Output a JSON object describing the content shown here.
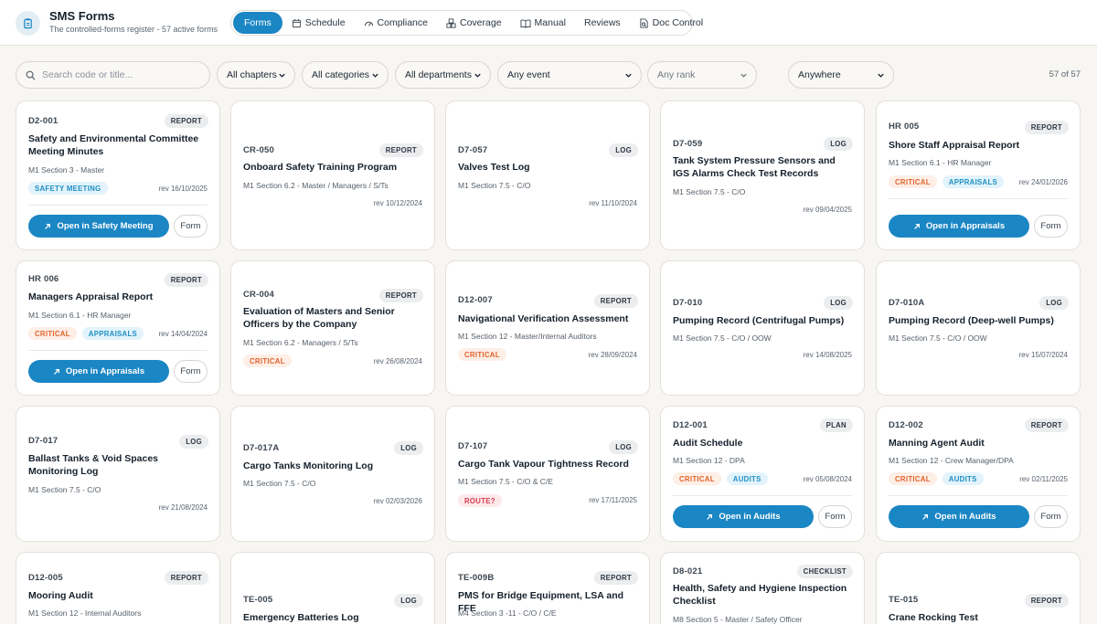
{
  "app": {
    "title": "SMS Forms",
    "subtitle": "The controlled-forms register - 57 active forms"
  },
  "nav": {
    "forms": "Forms",
    "schedule": "Schedule",
    "compliance": "Compliance",
    "coverage": "Coverage",
    "manual": "Manual",
    "reviews": "Reviews",
    "doc_control": "Doc Control"
  },
  "filters": {
    "search_placeholder": "Search code or title...",
    "chapters": "All chapters",
    "categories": "All categories",
    "departments": "All departments",
    "event": "Any event",
    "rank": "Any rank",
    "location": "Anywhere",
    "count": "57 of 57"
  },
  "colors": {
    "accent": "#1b86c4",
    "critical": "#e0632a",
    "route": "#d63c4e"
  },
  "cards": [
    {
      "code": "D2-001",
      "type": "REPORT",
      "title": "Safety and Environmental Committee Meeting Minutes",
      "meta": "M1 Section 3 - Master",
      "tags": [
        "SAFETY MEETING"
      ],
      "rev": "rev 16/10/2025",
      "open": "Open in Safety Meeting",
      "form": "Form"
    },
    {
      "code": "CR-050",
      "type": "REPORT",
      "title": "Onboard Safety Training Program",
      "meta": "M1 Section 6.2 - Master / Managers / S/Ts",
      "rev": "rev 10/12/2024"
    },
    {
      "code": "D7-057",
      "type": "LOG",
      "title": "Valves Test Log",
      "meta": "M1 Section 7.5 - C/O",
      "rev": "rev 11/10/2024"
    },
    {
      "code": "D7-059",
      "type": "LOG",
      "title": "Tank System Pressure Sensors and IGS Alarms Check Test Records",
      "meta": "M1 Section 7.5 - C/O",
      "rev": "rev 09/04/2025"
    },
    {
      "code": "HR 005",
      "type": "REPORT",
      "title": "Shore Staff Appraisal Report",
      "meta": "M1 Section 6.1 - HR Manager",
      "tags": [
        "CRITICAL",
        "APPRAISALS"
      ],
      "rev": "rev 24/01/2026",
      "open": "Open in Appraisals",
      "form": "Form"
    },
    {
      "code": "HR 006",
      "type": "REPORT",
      "title": "Managers Appraisal Report",
      "meta": "M1 Section 6.1 - HR Manager",
      "tags": [
        "CRITICAL",
        "APPRAISALS"
      ],
      "rev": "rev 14/04/2024",
      "open": "Open in Appraisals",
      "form": "Form"
    },
    {
      "code": "CR-004",
      "type": "REPORT",
      "title": "Evaluation of Masters and Senior Officers by the Company",
      "meta": "M1 Section 6.2 - Managers / S/Ts",
      "tags": [
        "CRITICAL"
      ],
      "rev": "rev 26/08/2024"
    },
    {
      "code": "D12-007",
      "type": "REPORT",
      "title": "Navigational Verification Assessment",
      "meta": "M1 Section 12 - Master/Internal Auditors",
      "tags": [
        "CRITICAL"
      ],
      "rev": "rev 28/09/2024"
    },
    {
      "code": "D7-010",
      "type": "LOG",
      "title": "Pumping Record (Centrifugal Pumps)",
      "meta": "M1 Section 7.5 - C/O / OOW",
      "rev": "rev 14/08/2025"
    },
    {
      "code": "D7-010A",
      "type": "LOG",
      "title": "Pumping Record (Deep-well Pumps)",
      "meta": "M1 Section 7.5 - C/O / OOW",
      "rev": "rev 15/07/2024"
    },
    {
      "code": "D7-017",
      "type": "LOG",
      "title": "Ballast Tanks & Void Spaces Monitoring Log",
      "meta": "M1 Section 7.5 - C/O",
      "rev": "rev 21/08/2024"
    },
    {
      "code": "D7-017A",
      "type": "LOG",
      "title": "Cargo Tanks Monitoring Log",
      "meta": "M1 Section 7.5 - C/O",
      "rev": "rev 02/03/2026"
    },
    {
      "code": "D7-107",
      "type": "LOG",
      "title": "Cargo Tank Vapour Tightness Record",
      "meta": "M1 Section 7.5 - C/O & C/E",
      "tags": [
        "ROUTE?"
      ],
      "rev": "rev 17/11/2025"
    },
    {
      "code": "D12-001",
      "type": "PLAN",
      "title": "Audit Schedule",
      "meta": "M1 Section 12 - DPA",
      "tags": [
        "CRITICAL",
        "AUDITS"
      ],
      "rev": "rev 05/08/2024",
      "open": "Open in Audits",
      "form": "Form"
    },
    {
      "code": "D12-002",
      "type": "REPORT",
      "title": "Manning Agent Audit",
      "meta": "M1 Section 12 - Crew Manager/DPA",
      "tags": [
        "CRITICAL",
        "AUDITS"
      ],
      "rev": "rev 02/11/2025",
      "open": "Open in Audits",
      "form": "Form"
    },
    {
      "code": "D12-005",
      "type": "REPORT",
      "title": "Mooring Audit",
      "meta": "M1 Section 12 - Internal Auditors"
    },
    {
      "code": "TE-005",
      "type": "LOG",
      "title": "Emergency Batteries Log"
    },
    {
      "code": "TE-009B",
      "type": "REPORT",
      "title": "PMS for Bridge Equipment, LSA and FFE",
      "meta": "M4 Section 3 -11 - C/O / C/E"
    },
    {
      "code": "D8-021",
      "type": "CHECKLIST",
      "title": "Health, Safety and Hygiene Inspection Checklist",
      "meta": "M8 Section 5 - Master / Safety Officer"
    },
    {
      "code": "TE-015",
      "type": "REPORT",
      "title": "Crane Rocking Test"
    }
  ]
}
